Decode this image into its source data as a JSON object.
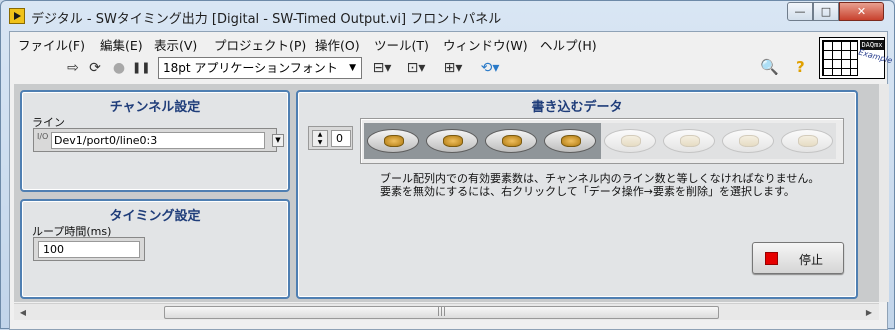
{
  "window": {
    "title": "デジタル - SWタイミング出力 [Digital - SW-Timed Output.vi] フロントパネル",
    "buttons": {
      "minimize": "—",
      "maximize": "□",
      "close": "✕"
    }
  },
  "menu": [
    "ファイル(F)",
    "編集(E)",
    "表示(V)",
    "プロジェクト(P)",
    "操作(O)",
    "ツール(T)",
    "ウィンドウ(W)",
    "ヘルプ(H)"
  ],
  "toolbar": {
    "run": "⇨",
    "run_continuous": "⟳",
    "abort": "●",
    "pause": "❚❚",
    "font": "18pt アプリケーションフォント",
    "font_arrow": "▼",
    "align": "⊟▾",
    "distribute": "⊡▾",
    "resize": "⊞▾",
    "reorder": "⟲▾",
    "context_help": "🔍",
    "help": "?"
  },
  "vi_icon": {
    "daq": "DAQmx",
    "example": "Example"
  },
  "channel_panel": {
    "title": "チャンネル設定",
    "line_label": "ライン",
    "io_icon": "I/O",
    "line_value": "Dev1/port0/line0:3",
    "dropdown": "▼"
  },
  "timing_panel": {
    "title": "タイミング設定",
    "loop_label": "ループ時間(ms)",
    "loop_value": "100"
  },
  "data_panel": {
    "title": "書き込むデータ",
    "index_value": "0",
    "spin_up": "▲",
    "spin_down": "▼",
    "leds": [
      true,
      true,
      true,
      true,
      false,
      false,
      false,
      false
    ],
    "note_line1": "ブール配列内での有効要素数は、チャンネル内のライン数と等しくなければなりません。",
    "note_line2": "要素を無効にするには、右クリックして「データ操作→要素を削除」を選択します。",
    "stop_label": "停止"
  },
  "scroll": {
    "left": "◀",
    "right": "▶",
    "grip": "|||"
  }
}
